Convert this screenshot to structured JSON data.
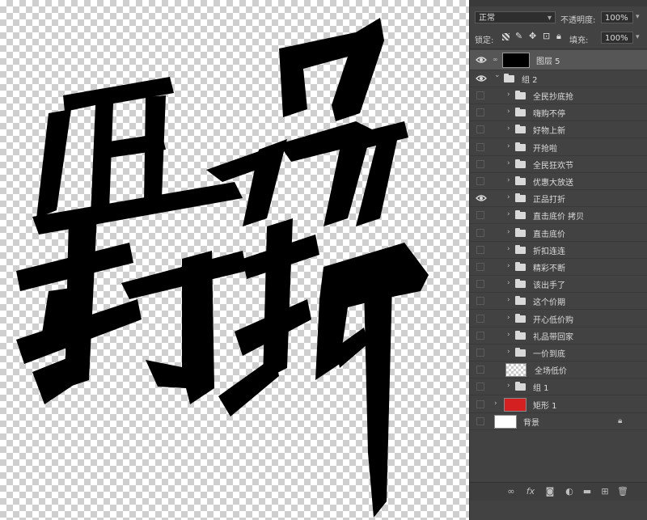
{
  "panel": {
    "blend_mode": "正常",
    "opacity_label": "不透明度:",
    "opacity_value": "100%",
    "lock_label": "锁定:",
    "fill_label": "填充:",
    "fill_value": "100%"
  },
  "layers": [
    {
      "name": "图层 5",
      "kind": "layer",
      "visible": true,
      "selected": true
    },
    {
      "name": "组 2",
      "kind": "group-open",
      "visible": true
    },
    {
      "name": "全民抄底抢",
      "kind": "group",
      "visible": false
    },
    {
      "name": "嗨购不停",
      "kind": "group",
      "visible": false
    },
    {
      "name": "好物上新",
      "kind": "group",
      "visible": false
    },
    {
      "name": "开抢啦",
      "kind": "group",
      "visible": false
    },
    {
      "name": "全民狂欢节",
      "kind": "group",
      "visible": false
    },
    {
      "name": "优惠大放送",
      "kind": "group",
      "visible": false
    },
    {
      "name": "正品打折",
      "kind": "group",
      "visible": true
    },
    {
      "name": "直击底价 拷贝",
      "kind": "group",
      "visible": false
    },
    {
      "name": "直击底价",
      "kind": "group",
      "visible": false
    },
    {
      "name": "折扣连连",
      "kind": "group",
      "visible": false
    },
    {
      "name": "精彩不断",
      "kind": "group",
      "visible": false
    },
    {
      "name": "该出手了",
      "kind": "group",
      "visible": false
    },
    {
      "name": "这个价期",
      "kind": "group",
      "visible": false
    },
    {
      "name": "开心低价购",
      "kind": "group",
      "visible": false
    },
    {
      "name": "礼品带回家",
      "kind": "group",
      "visible": false
    },
    {
      "name": "一价到底",
      "kind": "group",
      "visible": false
    },
    {
      "name": "全场低价",
      "kind": "smart",
      "visible": false
    },
    {
      "name": "组 1",
      "kind": "group-top",
      "visible": false
    },
    {
      "name": "矩形 1",
      "kind": "shape",
      "visible": false
    },
    {
      "name": "背景",
      "kind": "background",
      "visible": false
    }
  ],
  "colors": {
    "rect_thumb": "#d42020",
    "selected_row": "#565656"
  },
  "icons": [
    "eye-icon",
    "folder-icon",
    "link-icon",
    "fx-icon",
    "mask-icon",
    "adjustment-icon",
    "new-group-icon",
    "new-layer-icon",
    "trash-icon",
    "lock-icon"
  ]
}
